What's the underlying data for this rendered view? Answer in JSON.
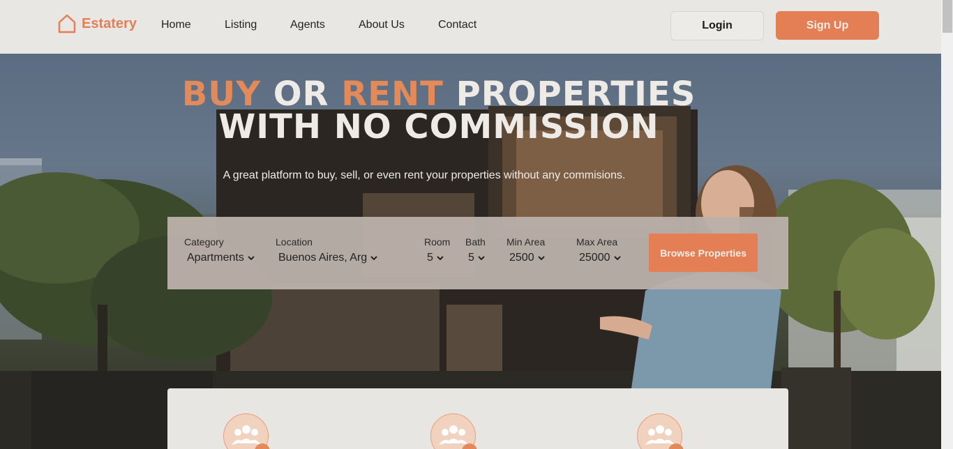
{
  "brand": {
    "name": "Estatery"
  },
  "nav": {
    "links": [
      "Home",
      "Listing",
      "Agents",
      "About Us",
      "Contact"
    ]
  },
  "auth": {
    "login_label": "Login",
    "signup_label": "Sign Up"
  },
  "hero": {
    "headline_line1_word1": "BUY",
    "headline_line1_word2": "OR",
    "headline_line1_word3": "RENT",
    "headline_line1_word4": "PROPERTIES",
    "headline_line2": "WITH NO COMMISSION",
    "subtitle": "A great platform to buy, sell, or even rent your properties without any commisions."
  },
  "search": {
    "fields": [
      {
        "label": "Category",
        "value": "Apartments"
      },
      {
        "label": "Location",
        "value": "Buenos Aires, Arg"
      },
      {
        "label": "Room",
        "value": "5"
      },
      {
        "label": "Bath",
        "value": "5"
      },
      {
        "label": "Min Area",
        "value": "2500"
      },
      {
        "label": "Max Area",
        "value": "25000"
      }
    ],
    "browse_label": "Browse Properties"
  },
  "colors": {
    "accent": "#e37e55",
    "accent_light": "#e38a5a",
    "panel": "#bab0aa",
    "background": "#e8e6e2"
  },
  "icons": {
    "logo": "house-outline-icon",
    "feature": "users-group-icon",
    "select": "chevron-down-icon"
  }
}
